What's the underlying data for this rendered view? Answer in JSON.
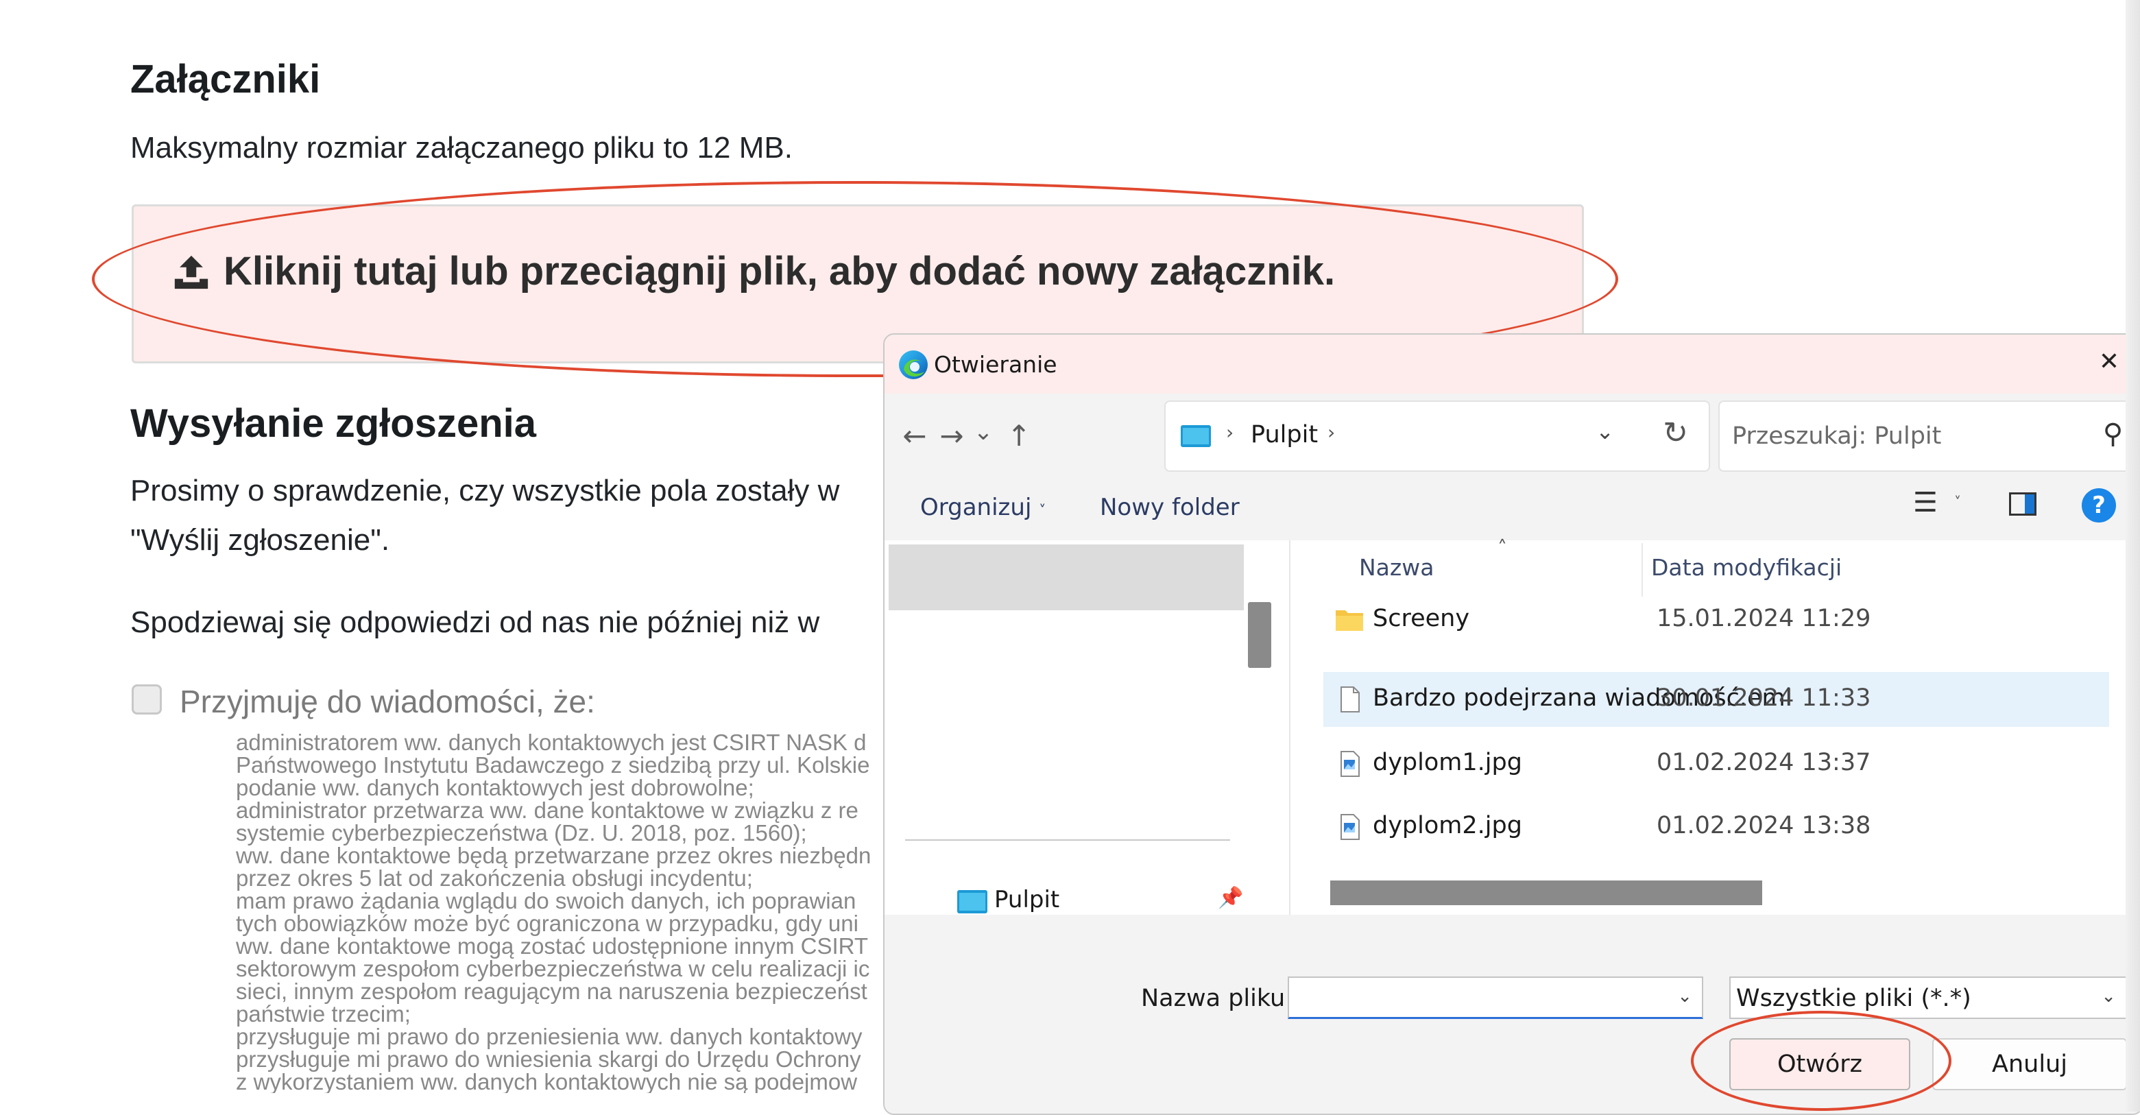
{
  "page": {
    "attachments_title": "Załączniki",
    "max_size_text": "Maksymalny rozmiar załączanego pliku to 12 MB.",
    "dropzone_text": "Kliknij tutaj lub przeciągnij plik, aby dodać nowy załącznik.",
    "submit_title": "Wysyłanie zgłoszenia",
    "submit_line1": "Prosimy o sprawdzenie, czy wszystkie pola zostały w",
    "submit_line2": "\"Wyślij zgłoszenie\".",
    "response_text": "Spodziewaj się odpowiedzi od nas nie później niż w",
    "consent_label": "Przyjmuję do wiadomości, że:",
    "consent_items": [
      {
        "lines": [
          "administratorem ww. danych kontaktowych jest CSIRT NASK d",
          "Państwowego Instytutu Badawczego z siedzibą przy ul. Kolskie"
        ]
      },
      {
        "lines": [
          "podanie ww. danych kontaktowych jest dobrowolne;"
        ]
      },
      {
        "lines": [
          "administrator przetwarza ww. dane kontaktowe w związku z re",
          "systemie cyberbezpieczeństwa (Dz. U. 2018, poz. 1560);"
        ]
      },
      {
        "lines": [
          "ww. dane kontaktowe będą przetwarzane przez okres niezbędn",
          "przez okres 5 lat od zakończenia obsługi incydentu;"
        ]
      },
      {
        "lines": [
          "mam prawo żądania wglądu do swoich danych, ich poprawian",
          "tych obowiązków może być ograniczona w przypadku, gdy uni"
        ]
      },
      {
        "lines": [
          "ww. dane kontaktowe mogą zostać udostępnione innym CSIRT",
          "sektorowym zespołom cyberbezpieczeństwa w celu realizacji ic",
          "sieci, innym zespołom reagującym na naruszenia bezpieczeńst",
          "państwie trzecim;"
        ]
      },
      {
        "lines": [
          "przysługuje mi prawo do przeniesienia ww. danych kontaktowy"
        ]
      },
      {
        "lines": [
          "przysługuje mi prawo do wniesienia skargi do Urzędu Ochrony"
        ]
      },
      {
        "lines": [
          "z wykorzystaniem ww. danych kontaktowych nie są podejmow"
        ]
      }
    ]
  },
  "dialog": {
    "title": "Otwieranie",
    "close_glyph": "✕",
    "nav": {
      "back": "←",
      "forward": "→",
      "recent": "⌄",
      "up": "↑"
    },
    "address": {
      "separator": "›",
      "current": "Pulpit",
      "dropdown": "⌄",
      "refresh": "↻"
    },
    "search_placeholder": "Przeszukaj: Pulpit",
    "search_glyph": "⚲",
    "toolbar": {
      "organize": "Organizuj",
      "organize_caret": "˅",
      "new_folder": "Nowy folder",
      "view_glyph": "☰",
      "view_caret": "˅",
      "help": "?"
    },
    "nav_pane": {
      "pulpit_label": "Pulpit",
      "pin_glyph": "📌"
    },
    "columns": {
      "name": "Nazwa",
      "date": "Data modyfikacji",
      "sort_glyph": "˄"
    },
    "files": [
      {
        "name": "Screeny",
        "date": "15.01.2024 11:29",
        "kind": "folder-icon"
      },
      {
        "name": "Bardzo podejrzana wiadomość.eml",
        "date": "30.01.2024 11:33",
        "kind": "document-icon"
      },
      {
        "name": "dyplom1.jpg",
        "date": "01.02.2024 13:37",
        "kind": "image-icon"
      },
      {
        "name": "dyplom2.jpg",
        "date": "01.02.2024 13:38",
        "kind": "image-icon"
      }
    ],
    "filename_label": "Nazwa pliku:",
    "filename_value": "",
    "filetype_value": "Wszystkie pliki (*.*)",
    "open_label": "Otwórz",
    "cancel_label": "Anuluj",
    "caret_glyph": "⌄"
  },
  "colors": {
    "annotation": "#e0482f",
    "dropzone_bg": "#fdeceb",
    "selected_row": "#e5f1fb",
    "help_blue": "#1a86e8"
  }
}
